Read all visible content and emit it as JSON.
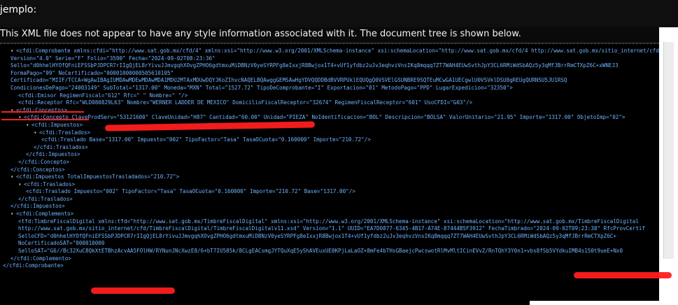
{
  "top_label": "jemplo:",
  "notice": "This XML file does not appear to have any style information associated with it. The document tree is shown below.",
  "lines": [
    {
      "indent": 0,
      "tri": "▾",
      "text": "<cfdi:Comprobante xmlns:cfdi=\"http://www.sat.gob.mx/cfd/4\" xmlns:xsi=\"http://www.w3.org/2001/XMLSchema-instance\" xsi:schemaLocation=\"http://www.sat.gob.mx/cfd/4 http://www.sat.gob.mx/sitio_internet/cfd/4/cfdv40.xsd\""
    },
    {
      "indent": 0,
      "tri": "",
      "text": " Version=\"4.0\" Serie=\"F\" Folio=\"3590\" Fecha=\"2024-09-02T08:23:36\""
    },
    {
      "indent": 0,
      "tri": "",
      "text": " Sello=\"d0hhelHYOfQFniEFSSbPJDPCR7rIIgQjEL8rYivuJJmvgqhXOvgZPHO6gdtmxuMiDBNzV0yeSYRPFg8eIxxjR8Bwjox1T4+vUf1yfdbz2uJv3eqhvzVnsIKq8mqqq7ZT7WAH4EUwSvthJpY3CL6RMiWdSbAQz5y3qMfJBrrRmCTXpZ6C+xWNEJ3"
    },
    {
      "indent": 0,
      "tri": "",
      "text": " FormaPago=\"99\" NoCertificado=\"00001000000505610105\""
    },
    {
      "indent": 0,
      "tri": "",
      "text": " Certificado=\"MIIF/TCCA+WgAwIBAgIUMDAwMDEwMDAwMDA1MDU2MTAxMDUwDQYJKoZIhvcNAQELBQAwggGEMSAwHgYDVQQDDBdBVVRPUklEQUQgQ0VSVElGSUNBRE9SQTEuMCwGA1UECgwlU0VSVklDSU8gREUgQURNSU5JU1RSQ"
    },
    {
      "indent": 0,
      "tri": "",
      "text": " CondicionesDePago=\"24003149\" SubTotal=\"1317.00\" Moneda=\"MXN\" Total=\"1527.72\" TipoDeComprobante=\"I\" Exportacion=\"01\" MetodoPago=\"PPD\" LugarExpedicion=\"32350\">"
    },
    {
      "indent": 1,
      "tri": "",
      "text": "<cfdi:Emisor RegimenFiscal=\"612\" Rfc=\"              \" Nombre=\"                              \"/>"
    },
    {
      "indent": 1,
      "tri": "",
      "text": "<cfdi:Receptor Rfc=\"WLD080829L63\" Nombre=\"WERNER LADDER DE MEXICO\" DomicilioFiscalReceptor=\"32674\" RegimenFiscalReceptor=\"601\" UsoCFDI=\"G03\"/>"
    },
    {
      "indent": 0,
      "tri": "▾",
      "text": "<cfdi:Conceptos>"
    },
    {
      "indent": 1,
      "tri": "▾",
      "text": "<cfdi:Concepto ClaveProdServ=\"53121600\" ClaveUnidad=\"H87\" Cantidad=\"60.00\" Unidad=\"PIEZA\" NoIdentificacion=\"BOL\" Descripcion=\"BOLSA\" ValorUnitario=\"21.95\" Importe=\"1317.00\" ObjetoImp=\"02\">"
    },
    {
      "indent": 2,
      "tri": "▾",
      "text": "<cfdi:Impuestos>"
    },
    {
      "indent": 3,
      "tri": "▾",
      "text": "<cfdi:Traslados>"
    },
    {
      "indent": 4,
      "tri": "",
      "text": "<cfdi:Traslado Base=\"1317.00\" Impuesto=\"002\" TipoFactor=\"Tasa\" TasaOCuota=\"0.160000\" Importe=\"210.72\"/>"
    },
    {
      "indent": 3,
      "tri": "",
      "text": "</cfdi:Traslados>"
    },
    {
      "indent": 2,
      "tri": "",
      "text": "</cfdi:Impuestos>"
    },
    {
      "indent": 1,
      "tri": "",
      "text": "</cfdi:Concepto>"
    },
    {
      "indent": 0,
      "tri": "",
      "text": "</cfdi:Conceptos>"
    },
    {
      "indent": 0,
      "tri": "▾",
      "text": "<cfdi:Impuestos TotalImpuestosTrasladados=\"210.72\">"
    },
    {
      "indent": 1,
      "tri": "▾",
      "text": "<cfdi:Traslados>"
    },
    {
      "indent": 2,
      "tri": "",
      "text": "<cfdi:Traslado Impuesto=\"002\" TipoFactor=\"Tasa\" TasaOCuota=\"0.160000\" Importe=\"210.72\" Base=\"1317.00\"/>"
    },
    {
      "indent": 1,
      "tri": "",
      "text": "</cfdi:Traslados>"
    },
    {
      "indent": 0,
      "tri": "",
      "text": "</cfdi:Impuestos>"
    },
    {
      "indent": 0,
      "tri": "▾",
      "text": "<cfdi:Complemento>"
    },
    {
      "indent": 1,
      "tri": "",
      "text": "<tfd:TimbreFiscalDigital xmlns:tfd=\"http://www.sat.gob.mx/TimbreFiscalDigital\" xmlns:xsi=\"http://www.w3.org/2001/XMLSchema-instance\" xsi:schemaLocation=\"http://www.sat.gob.mx/TimbreFiscalDigital"
    },
    {
      "indent": 1,
      "tri": "",
      "text": " http://www.sat.gob.mx/sitio_internet/cfd/TimbreFiscalDigital/TimbreFiscalDigitalv11.xsd\" Version=\"1.1\" UUID=\"EA7D0877-6345-4B17-A74E-87444B5F3912\" FechaTimbrado=\"2024-09-02T09:23:38\" RfcProvCertif"
    },
    {
      "indent": 1,
      "tri": "",
      "text": " SelloCFD=\"d0hhelHYOfQFniEFSSbPJDPCR7rIIgQjEL8rYivuJJmvgqhXOvgZPHO6gdtmxuMiDBNzV0yeSYRPFg8eIxxjR8Bwjox1T4+vUf1yfdbz2uJv3eqhvzVnsIKq8mqqq7ZT7WAH4EUwSvthJpY3CL6RMiWdSbAQz5y3qMfJBrrRmCTXpZ6C+"
    },
    {
      "indent": 1,
      "tri": "",
      "text": " NoCertificadoSAT=\"000010000"
    },
    {
      "indent": 1,
      "tri": "",
      "text": " SelloSAT=\"G6//Bc32XuC8QkXtETBhzAcvAA5FOlHW/RYNunJNcXwzE8/6+bT7IU585k/8CLgEACsmgJYTQuXqE5yShAVEuxUE0KPjLaLaOZ+8mFe4bTHsGBaejcPwcswotRlMvMltICinEVvZ/RnTQhY3Y0n1+vbs8fSb5VYdkuIMB4s150t9ueE+Nx0"
    },
    {
      "indent": 0,
      "tri": "",
      "text": "</cfdi:Complemento>"
    },
    {
      "indent": -1,
      "tri": "",
      "text": "</cfdi:Comprobante>"
    }
  ]
}
